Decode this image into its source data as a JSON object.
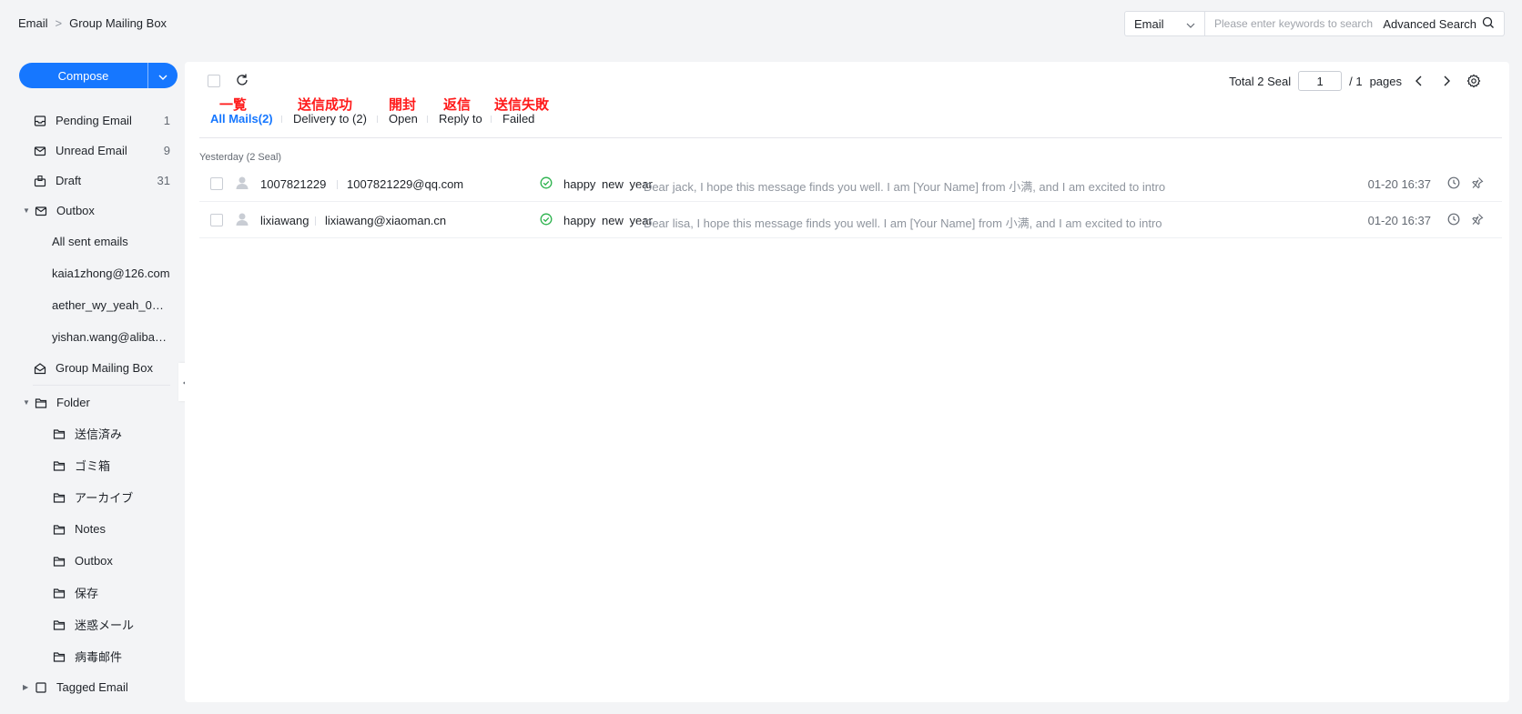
{
  "breadcrumb": {
    "root": "Email",
    "separator": ">",
    "current": "Group Mailing Box"
  },
  "search": {
    "type": "Email",
    "placeholder": "Please enter keywords to search",
    "advanced": "Advanced Search"
  },
  "compose": {
    "label": "Compose"
  },
  "sidebar": {
    "pending": {
      "label": "Pending Email",
      "count": "1"
    },
    "unread": {
      "label": "Unread Email",
      "count": "9"
    },
    "draft": {
      "label": "Draft",
      "count": "31"
    },
    "outbox": {
      "label": "Outbox",
      "items": [
        "All sent emails",
        "kaia1zhong@126.com",
        "aether_wy_yeah_01@...",
        "yishan.wang@alibaba-..."
      ]
    },
    "group_mailing": {
      "label": "Group Mailing Box"
    },
    "folder": {
      "label": "Folder",
      "items": [
        "送信済み",
        "ゴミ箱",
        "アーカイブ",
        "Notes",
        "Outbox",
        "保存",
        "迷惑メール",
        "病毒邮件"
      ]
    },
    "tagged": {
      "label": "Tagged Email"
    }
  },
  "toolbar": {
    "total": "Total 2 Seal",
    "page": "1",
    "of": "/ 1",
    "pages": "pages"
  },
  "annotations": [
    "一覧",
    "送信成功",
    "開封",
    "返信",
    "送信失敗"
  ],
  "tabs": [
    "All Mails(2)",
    "Delivery to (2)",
    "Open",
    "Reply to",
    "Failed"
  ],
  "group_label": "Yesterday (2 Seal)",
  "rows": [
    {
      "from": "1007821229",
      "addr": "1007821229@qq.com",
      "subject": "happy new year",
      "preview": "- Dear jack, I hope this message finds you well. I am [Your Name] from 小满, and I am excited to intro",
      "date": "01-20 16:37"
    },
    {
      "from": "lixiawang",
      "addr": "lixiawang@xiaoman.cn",
      "subject": "happy new year",
      "preview": "- Dear lisa, I hope this message finds you well. I am [Your Name] from 小满, and I am excited to intro",
      "date": "01-20 16:37"
    }
  ],
  "colors": {
    "accent": "#1677ff",
    "annotation": "#ff1b1b",
    "success": "#2bb24c"
  }
}
